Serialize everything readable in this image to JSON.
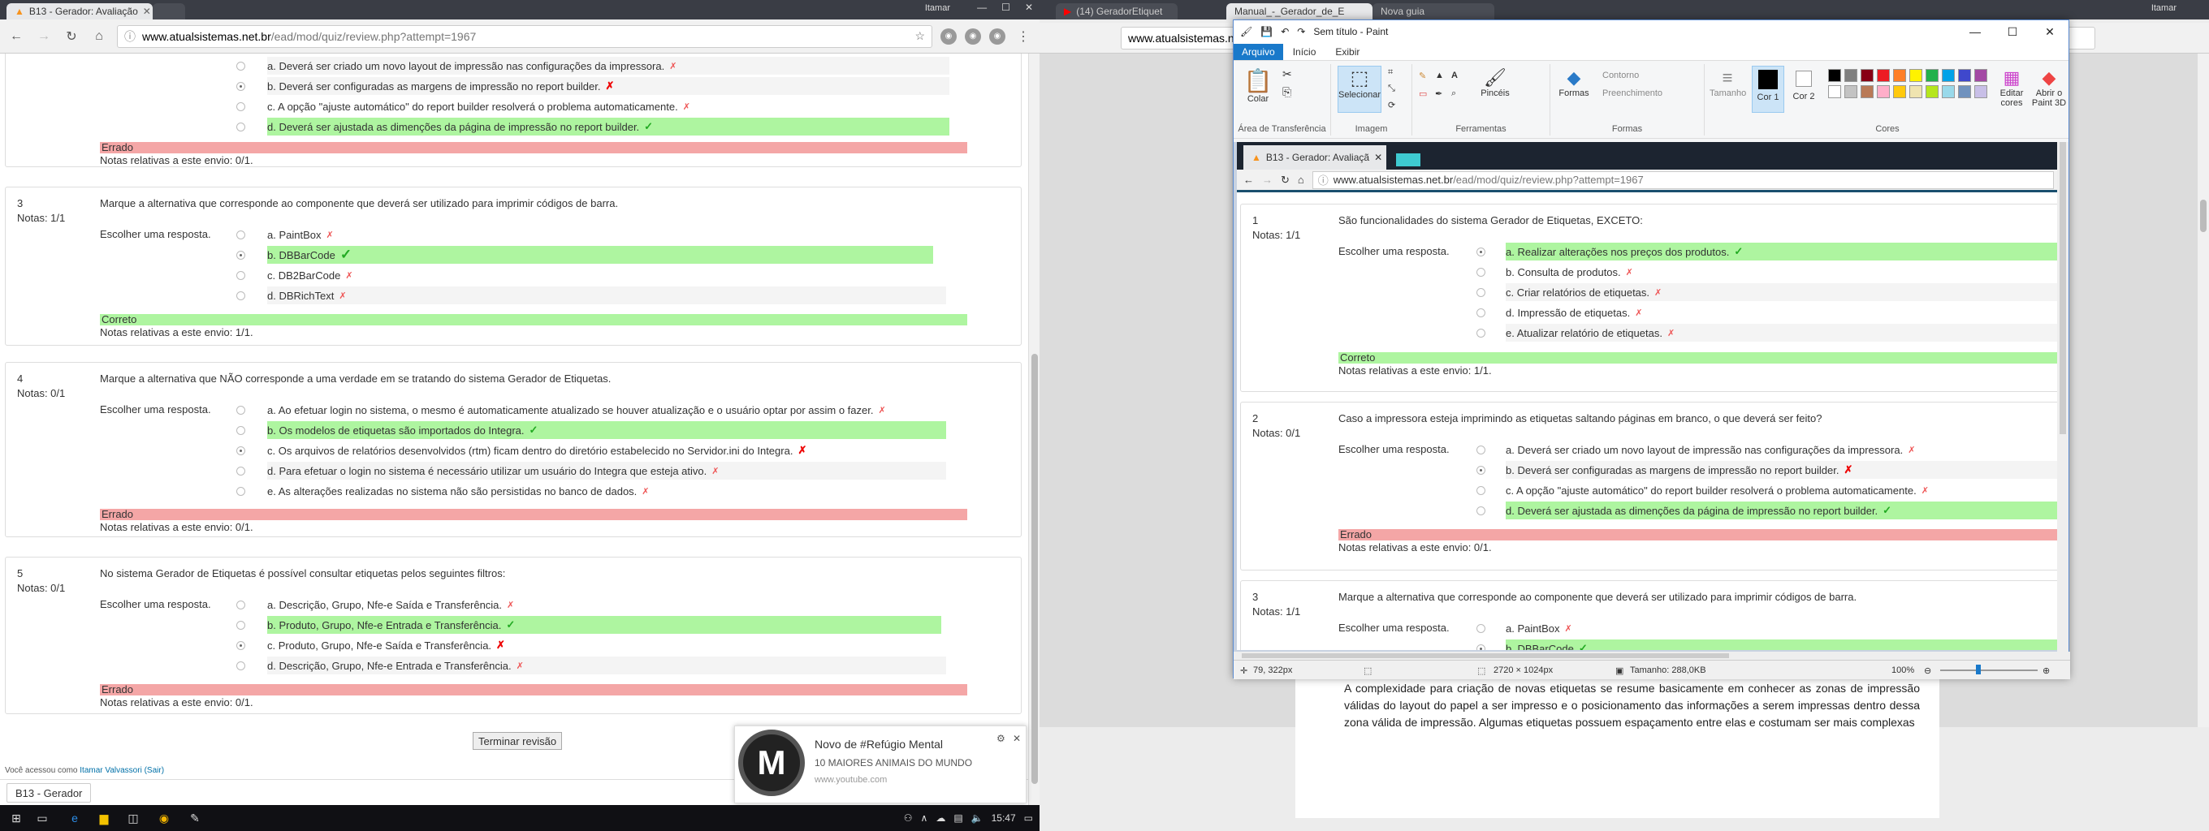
{
  "left_browser": {
    "tabs": [
      {
        "title": "B13 - Gerador: Avaliação",
        "active": true
      },
      {
        "title": "",
        "active": false
      }
    ],
    "user": "Itamar",
    "url_host": "www.atualsistemas.net.br",
    "url_path": "/ead/mod/quiz/review.php?attempt=1967",
    "partial_question": {
      "options": [
        {
          "text": "a. Deverá ser criado um novo layout de impressão nas configurações da impressora.",
          "mark": "x-small",
          "selected": false,
          "correct": false
        },
        {
          "text": "b. Deverá ser configuradas as margens de impressão no report builder.",
          "mark": "x",
          "selected": true,
          "correct": false
        },
        {
          "text": "c. A opção \"ajuste automático\" do report builder resolverá o problema automaticamente.",
          "mark": "x-small",
          "selected": false,
          "correct": false
        },
        {
          "text": "d. Deverá ser ajustada as dimenções da página de impressão no report builder.",
          "mark": "ok",
          "selected": false,
          "correct": true
        }
      ],
      "status": "Errado",
      "note": "Notas relativas a este envio: 0/1."
    },
    "questions": [
      {
        "number": "3",
        "grade": "Notas: 1/1",
        "text": "Marque a alternativa que corresponde ao componente que deverá ser utilizado para imprimir códigos de barra.",
        "label": "Escolher uma resposta.",
        "options": [
          {
            "text": "a. PaintBox",
            "mark": "x-small",
            "selected": false,
            "correct": false
          },
          {
            "text": "b. DBBarCode",
            "mark": "ok",
            "selected": true,
            "correct": true
          },
          {
            "text": "c. DB2BarCode",
            "mark": "x-small",
            "selected": false,
            "correct": false
          },
          {
            "text": "d. DBRichText",
            "mark": "x-small",
            "selected": false,
            "correct": false
          }
        ],
        "status": "Correto",
        "note": "Notas relativas a este envio: 1/1."
      },
      {
        "number": "4",
        "grade": "Notas: 0/1",
        "text": "Marque a alternativa que NÃO corresponde a uma verdade em se tratando do sistema Gerador de Etiquetas.",
        "label": "Escolher uma resposta.",
        "options": [
          {
            "text": "a. Ao efetuar login no sistema, o mesmo é automaticamente atualizado se houver atualização e o usuário optar por assim o fazer.",
            "mark": "x-small",
            "selected": false,
            "correct": false
          },
          {
            "text": "b. Os modelos de etiquetas são importados do Integra.",
            "mark": "ok",
            "selected": false,
            "correct": true
          },
          {
            "text": "c. Os arquivos de relatórios desenvolvidos (rtm) ficam dentro do diretório estabelecido no Servidor.ini do Integra.",
            "mark": "x",
            "selected": true,
            "correct": false
          },
          {
            "text": "d. Para efetuar o login no sistema é necessário utilizar um usuário do Integra que esteja ativo.",
            "mark": "x-small",
            "selected": false,
            "correct": false
          },
          {
            "text": "e. As alterações realizadas no sistema não são persistidas no banco de dados.",
            "mark": "x-small",
            "selected": false,
            "correct": false
          }
        ],
        "status": "Errado",
        "note": "Notas relativas a este envio: 0/1."
      },
      {
        "number": "5",
        "grade": "Notas: 0/1",
        "text": "No sistema Gerador de Etiquetas é possível consultar etiquetas pelos seguintes filtros:",
        "label": "Escolher uma resposta.",
        "options": [
          {
            "text": "a. Descrição, Grupo, Nfe-e Saída e Transferência.",
            "mark": "x-small",
            "selected": false,
            "correct": false
          },
          {
            "text": "b. Produto, Grupo, Nfe-e Entrada e Transferência.",
            "mark": "ok",
            "selected": false,
            "correct": true
          },
          {
            "text": "c. Produto, Grupo, Nfe-e Saída e Transferência.",
            "mark": "x",
            "selected": true,
            "correct": false
          },
          {
            "text": "d. Descrição, Grupo, Nfe-e Entrada e Transferência.",
            "mark": "x-small",
            "selected": false,
            "correct": false
          }
        ],
        "status": "Errado",
        "note": "Notas relativas a este envio: 0/1."
      }
    ],
    "finish_button": "Terminar revisão",
    "login_prefix": "Você acessou como",
    "login_user": "Itamar Valvassori",
    "login_logout": "(Sair)",
    "download_item": "B13 - Gerador"
  },
  "notification": {
    "title": "Novo de #Refúgio Mental",
    "subtitle": "10 MAIORES ANIMAIS DO MUNDO",
    "source": "www.youtube.com",
    "logo_letter": "M"
  },
  "taskbar": {
    "time": "15:47"
  },
  "right_browser": {
    "tabs": [
      {
        "title": "(14) GeradorEtiquet",
        "active": false
      },
      {
        "title": "Manual_-_Gerador_de_E",
        "active": true
      },
      {
        "title": "Nova guia",
        "active": false
      }
    ],
    "user": "Itamar",
    "url_host": "www.atualsistemas.net.br",
    "document_text": "A complexidade para criação de novas etiquetas se resume basicamente em conhecer as zonas de impressão válidas do layout do papel a ser impresso e o posicionamento das informações a serem impressas dentro dessa zona válida de impressão. Algumas etiquetas possuem espaçamento entre elas e costumam ser mais complexas"
  },
  "paint": {
    "title": "Sem título - Paint",
    "menu": [
      "Arquivo",
      "Início",
      "Exibir"
    ],
    "groups": {
      "clipboard": "Área de Transferência",
      "image": "Imagem",
      "tools": "Ferramentas",
      "shapes": "Formas",
      "colors": "Cores"
    },
    "buttons": {
      "paste": "Colar",
      "select": "Selecionar",
      "brushes": "Pincéis",
      "shapes": "Formas",
      "outline": "Contorno",
      "fill": "Preenchimento",
      "size": "Tamanho",
      "color1": "Cor 1",
      "color2": "Cor 2",
      "edit_colors": "Editar cores",
      "paint3d": "Abrir o Paint 3D"
    },
    "palette": [
      "#000000",
      "#7f7f7f",
      "#880015",
      "#ed1c24",
      "#ff7f27",
      "#fff200",
      "#22b14c",
      "#00a2e8",
      "#3f48cc",
      "#a349a4",
      "#ffffff",
      "#c3c3c3",
      "#b97a57",
      "#ffaec9",
      "#ffc90e",
      "#efe4b0",
      "#b5e61d",
      "#99d9ea",
      "#7092be",
      "#c8bfe7"
    ],
    "status": {
      "cursor": "79, 322px",
      "dimensions": "2720 × 1024px",
      "size": "Tamanho: 288,0KB",
      "zoom": "100%"
    },
    "pasted": {
      "tab": "B13 - Gerador: Avaliaçã",
      "url_host": "www.atualsistemas.net.br",
      "url_path": "/ead/mod/quiz/review.php?attempt=1967",
      "questions": [
        {
          "number": "1",
          "grade": "Notas: 1/1",
          "text": "São funcionalidades do sistema Gerador de Etiquetas, EXCETO:",
          "label": "Escolher uma resposta.",
          "options": [
            {
              "text": "a. Realizar alterações nos preços dos produtos.",
              "mark": "ok",
              "selected": true,
              "correct": true
            },
            {
              "text": "b. Consulta de produtos.",
              "mark": "x-small",
              "selected": false,
              "correct": false
            },
            {
              "text": "c. Criar relatórios de etiquetas.",
              "mark": "x-small",
              "selected": false,
              "correct": false
            },
            {
              "text": "d. Impressão de etiquetas.",
              "mark": "x-small",
              "selected": false,
              "correct": false
            },
            {
              "text": "e. Atualizar relatório de etiquetas.",
              "mark": "x-small",
              "selected": false,
              "correct": false
            }
          ],
          "status": "Correto",
          "note": "Notas relativas a este envio: 1/1."
        },
        {
          "number": "2",
          "grade": "Notas: 0/1",
          "text": "Caso a impressora esteja imprimindo as etiquetas saltando páginas em branco, o que deverá ser feito?",
          "label": "Escolher uma resposta.",
          "options": [
            {
              "text": "a. Deverá ser criado um novo layout de impressão nas configurações da impressora.",
              "mark": "x-small",
              "selected": false,
              "correct": false
            },
            {
              "text": "b. Deverá ser configuradas as margens de impressão no report builder.",
              "mark": "x",
              "selected": true,
              "correct": false
            },
            {
              "text": "c. A opção \"ajuste automático\" do report builder resolverá o problema automaticamente.",
              "mark": "x-small",
              "selected": false,
              "correct": false
            },
            {
              "text": "d. Deverá ser ajustada as dimenções da página de impressão no report builder.",
              "mark": "ok",
              "selected": false,
              "correct": true
            }
          ],
          "status": "Errado",
          "note": "Notas relativas a este envio: 0/1."
        },
        {
          "number": "3",
          "grade": "Notas: 1/1",
          "text": "Marque a alternativa que corresponde ao componente que deverá ser utilizado para imprimir códigos de barra.",
          "label": "Escolher uma resposta.",
          "options": [
            {
              "text": "a. PaintBox",
              "mark": "x-small",
              "selected": false,
              "correct": false
            },
            {
              "text": "b. DBBarCode",
              "mark": "ok",
              "selected": true,
              "correct": true
            }
          ]
        }
      ]
    }
  }
}
